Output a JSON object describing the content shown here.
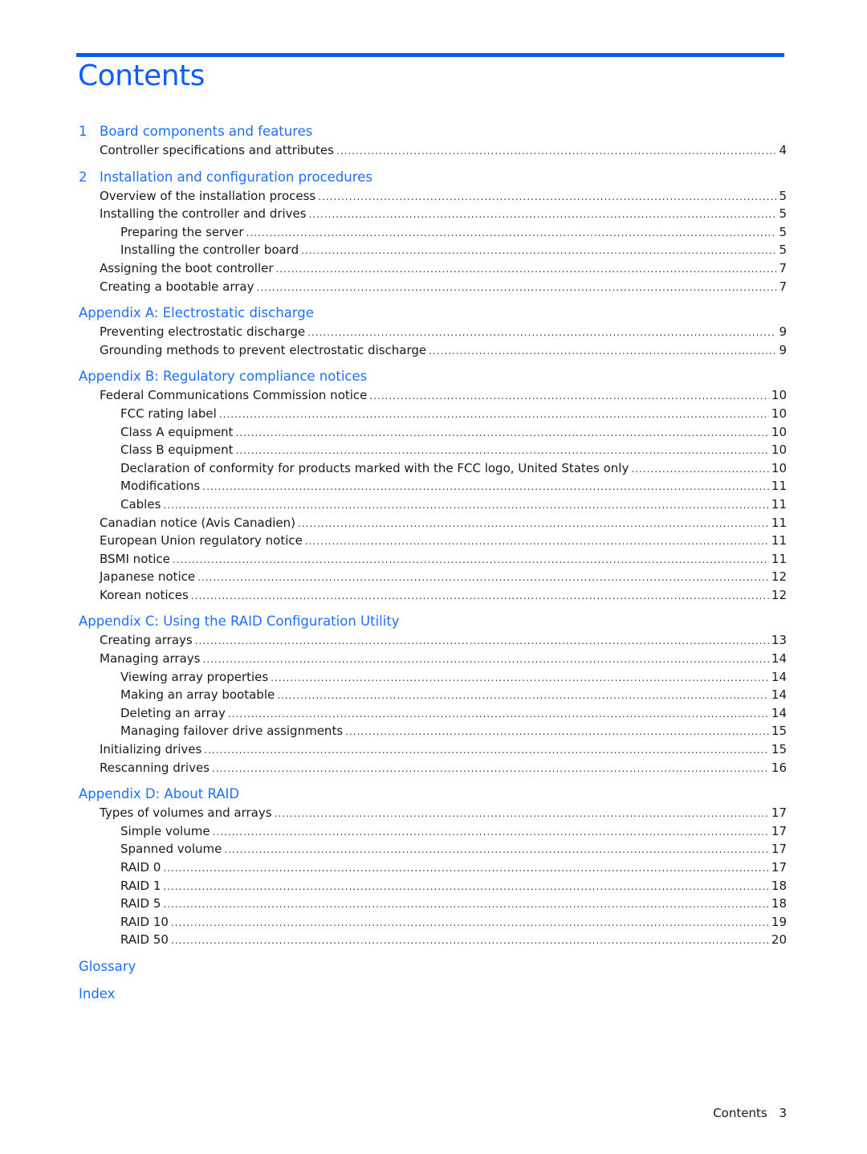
{
  "page_title": "Contents",
  "sections": [
    {
      "number": "1",
      "title": "Board components and features",
      "entries": [
        {
          "level": 1,
          "label": "Controller specifications and attributes",
          "page": "4"
        }
      ]
    },
    {
      "number": "2",
      "title": "Installation and configuration procedures",
      "entries": [
        {
          "level": 1,
          "label": "Overview of the installation process",
          "page": "5"
        },
        {
          "level": 1,
          "label": "Installing the controller and drives",
          "page": "5"
        },
        {
          "level": 2,
          "label": "Preparing the server",
          "page": "5"
        },
        {
          "level": 2,
          "label": "Installing the controller board",
          "page": "5"
        },
        {
          "level": 1,
          "label": "Assigning the boot controller",
          "page": "7"
        },
        {
          "level": 1,
          "label": "Creating a bootable array",
          "page": "7"
        }
      ]
    },
    {
      "number": "",
      "title": "Appendix A: Electrostatic discharge",
      "entries": [
        {
          "level": 1,
          "label": "Preventing electrostatic discharge",
          "page": "9"
        },
        {
          "level": 1,
          "label": "Grounding methods to prevent electrostatic discharge",
          "page": "9"
        }
      ]
    },
    {
      "number": "",
      "title": "Appendix B: Regulatory compliance notices",
      "entries": [
        {
          "level": 1,
          "label": "Federal Communications Commission notice",
          "page": "10"
        },
        {
          "level": 2,
          "label": "FCC rating label",
          "page": "10"
        },
        {
          "level": 2,
          "label": "Class A equipment",
          "page": "10"
        },
        {
          "level": 2,
          "label": "Class B equipment",
          "page": "10"
        },
        {
          "level": 2,
          "label": "Declaration of conformity for products marked with the FCC logo, United States only",
          "page": "10"
        },
        {
          "level": 2,
          "label": "Modifications",
          "page": "11"
        },
        {
          "level": 2,
          "label": "Cables",
          "page": "11"
        },
        {
          "level": 1,
          "label": "Canadian notice (Avis Canadien)",
          "page": "11"
        },
        {
          "level": 1,
          "label": "European Union regulatory notice",
          "page": "11"
        },
        {
          "level": 1,
          "label": "BSMI notice",
          "page": "11"
        },
        {
          "level": 1,
          "label": "Japanese notice",
          "page": "12"
        },
        {
          "level": 1,
          "label": "Korean notices",
          "page": "12"
        }
      ]
    },
    {
      "number": "",
      "title": "Appendix C: Using the RAID Configuration Utility",
      "entries": [
        {
          "level": 1,
          "label": "Creating arrays",
          "page": "13"
        },
        {
          "level": 1,
          "label": "Managing arrays",
          "page": "14"
        },
        {
          "level": 2,
          "label": "Viewing array properties",
          "page": "14"
        },
        {
          "level": 2,
          "label": "Making an array bootable",
          "page": "14"
        },
        {
          "level": 2,
          "label": "Deleting an array",
          "page": "14"
        },
        {
          "level": 2,
          "label": "Managing failover drive assignments",
          "page": "15"
        },
        {
          "level": 1,
          "label": "Initializing drives",
          "page": "15"
        },
        {
          "level": 1,
          "label": "Rescanning drives",
          "page": "16"
        }
      ]
    },
    {
      "number": "",
      "title": "Appendix D: About RAID",
      "entries": [
        {
          "level": 1,
          "label": "Types of volumes and arrays",
          "page": "17"
        },
        {
          "level": 2,
          "label": "Simple volume",
          "page": "17"
        },
        {
          "level": 2,
          "label": "Spanned volume",
          "page": "17"
        },
        {
          "level": 2,
          "label": "RAID 0",
          "page": "17"
        },
        {
          "level": 2,
          "label": "RAID 1",
          "page": "18"
        },
        {
          "level": 2,
          "label": "RAID 5",
          "page": "18"
        },
        {
          "level": 2,
          "label": "RAID 10",
          "page": "19"
        },
        {
          "level": 2,
          "label": "RAID 50",
          "page": "20"
        }
      ]
    },
    {
      "number": "",
      "title": "Glossary",
      "entries": []
    },
    {
      "number": "",
      "title": "Index",
      "entries": []
    }
  ],
  "footer": {
    "section_label": "Contents",
    "page_number": "3"
  },
  "colors": {
    "accent": "#0b5cff",
    "heading_link": "#1d6fff",
    "text": "#1a1a1a"
  }
}
